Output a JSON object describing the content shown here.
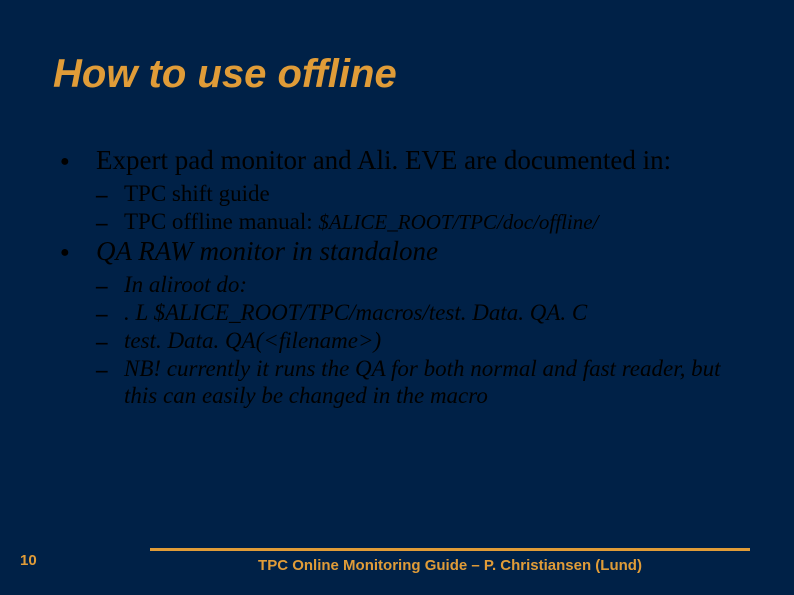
{
  "title": "How to use offline",
  "body": {
    "item1": {
      "text": "Expert pad monitor and Ali. EVE are documented in:",
      "sub1": "TPC shift guide",
      "sub2_a": "TPC offline manual: ",
      "sub2_b": "$ALICE_ROOT/TPC/doc/offline/"
    },
    "item2": {
      "text": "QA RAW monitor in standalone",
      "sub1": "In aliroot do:",
      "sub2": ". L $ALICE_ROOT/TPC/macros/test. Data. QA. C",
      "sub3": "test. Data. QA(<filename>)",
      "sub4": "NB! currently it runs the QA for both normal and fast reader, but this can easily be changed in the macro"
    }
  },
  "footer": "TPC Online Monitoring Guide – P. Christiansen (Lund)",
  "page": "10"
}
